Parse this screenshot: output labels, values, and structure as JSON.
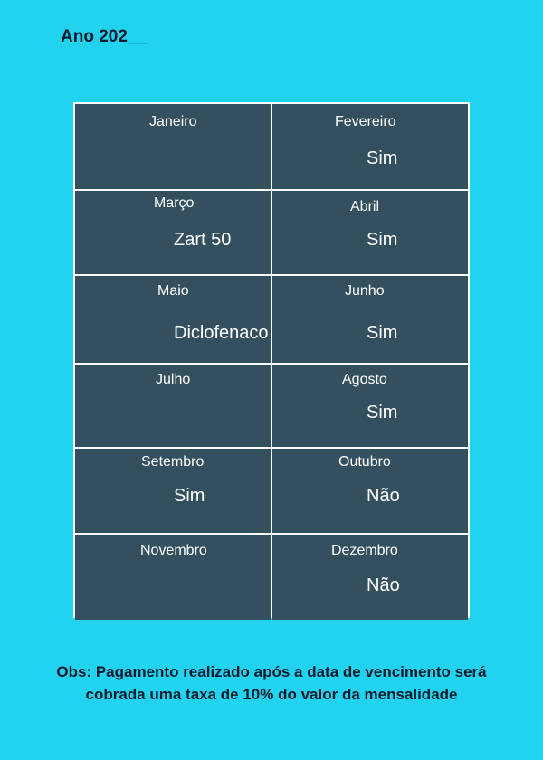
{
  "header": {
    "title": "Ano 202__"
  },
  "months": [
    {
      "name": "Janeiro",
      "value": ""
    },
    {
      "name": "Fevereiro",
      "value": "Sim"
    },
    {
      "name": "Março",
      "value": "Zart 50"
    },
    {
      "name": "Abril",
      "value": "Sim"
    },
    {
      "name": "Maio",
      "value": "Diclofenaco"
    },
    {
      "name": "Junho",
      "value": "Sim"
    },
    {
      "name": "Julho",
      "value": ""
    },
    {
      "name": "Agosto",
      "value": "Sim"
    },
    {
      "name": "Setembro",
      "value": "Sim"
    },
    {
      "name": "Outubro",
      "value": "Não"
    },
    {
      "name": "Novembro",
      "value": ""
    },
    {
      "name": "Dezembro",
      "value": "Não"
    }
  ],
  "footer": {
    "line1": "Obs: Pagamento realizado após a data de vencimento será",
    "line2": "cobrada uma taxa de 10% do valor da mensalidade"
  },
  "colors": {
    "background": "#21d3ef",
    "cell": "#34505f",
    "border": "#ffffff",
    "text_dark": "#0b1a2a"
  }
}
